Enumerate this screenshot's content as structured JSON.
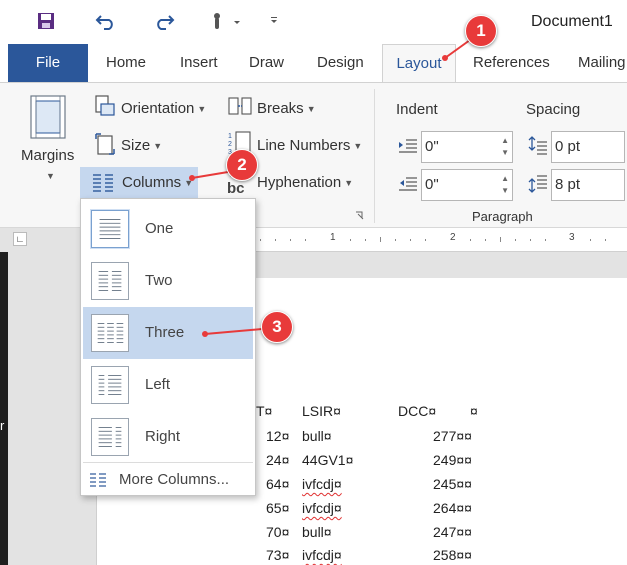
{
  "title_bar": {
    "document_title": "Document1",
    "qat_icons": [
      "save-icon",
      "undo-icon",
      "redo-icon",
      "touch-mode-icon",
      "customize-qat-icon"
    ]
  },
  "tabs": [
    {
      "label": "File"
    },
    {
      "label": "Home"
    },
    {
      "label": "Insert"
    },
    {
      "label": "Draw"
    },
    {
      "label": "Design"
    },
    {
      "label": "Layout",
      "active": true
    },
    {
      "label": "References"
    },
    {
      "label": "Mailing"
    }
  ],
  "ribbon": {
    "page_setup": {
      "margins": "Margins",
      "orientation": "Orientation",
      "size": "Size",
      "columns": "Columns",
      "breaks": "Breaks",
      "line_numbers": "Line Numbers",
      "hyphenation": "Hyphenation"
    },
    "paragraph": {
      "group_label": "Paragraph",
      "indent_label": "Indent",
      "spacing_label": "Spacing",
      "indent_left": "0\"",
      "indent_right": "0\"",
      "spacing_before": "0 pt",
      "spacing_after": "8 pt"
    }
  },
  "columns_menu": {
    "items": [
      {
        "label": "One",
        "selected": true
      },
      {
        "label": "Two"
      },
      {
        "label": "Three",
        "highlighted": true
      },
      {
        "label": "Left"
      },
      {
        "label": "Right"
      }
    ],
    "more": "More Columns..."
  },
  "ruler": {
    "ticks": [
      "1",
      "2",
      "3"
    ]
  },
  "document": {
    "header_row": [
      "T¤",
      "LSIR¤",
      "DCC¤",
      "¤"
    ],
    "rows": [
      {
        "n": "12¤",
        "name": "bull¤",
        "dcc": "277¤¤",
        "squiggle": false
      },
      {
        "n": "24¤",
        "name": "44GV1¤",
        "dcc": "249¤¤",
        "squiggle": false
      },
      {
        "n": "64¤",
        "name": "ivfcdj¤",
        "dcc": "245¤¤",
        "squiggle": true
      },
      {
        "n": "65¤",
        "name": "ivfcdj¤",
        "dcc": "264¤¤",
        "squiggle": true
      },
      {
        "n": "70¤",
        "name": "bull¤",
        "dcc": "247¤¤",
        "squiggle": false
      },
      {
        "n": "73¤",
        "name": "ivfcdj¤",
        "dcc": "258¤¤",
        "squiggle": true
      }
    ],
    "left_edge_char": "r"
  },
  "callouts": [
    "1",
    "2",
    "3"
  ],
  "colors": {
    "accent": "#2b579a",
    "highlight": "#c5d7ee",
    "callout": "#e83a3a"
  }
}
